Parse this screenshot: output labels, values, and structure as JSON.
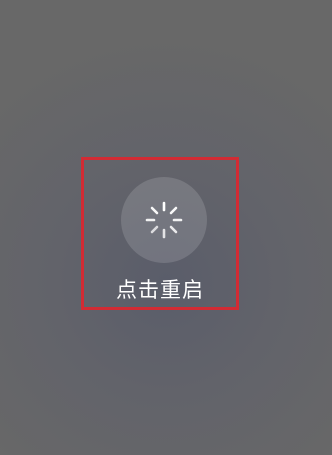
{
  "restart": {
    "label": "点击重启",
    "icon": "loading-spinner-icon"
  },
  "colors": {
    "highlight_border": "#d22b34",
    "label": "#ffffff"
  }
}
